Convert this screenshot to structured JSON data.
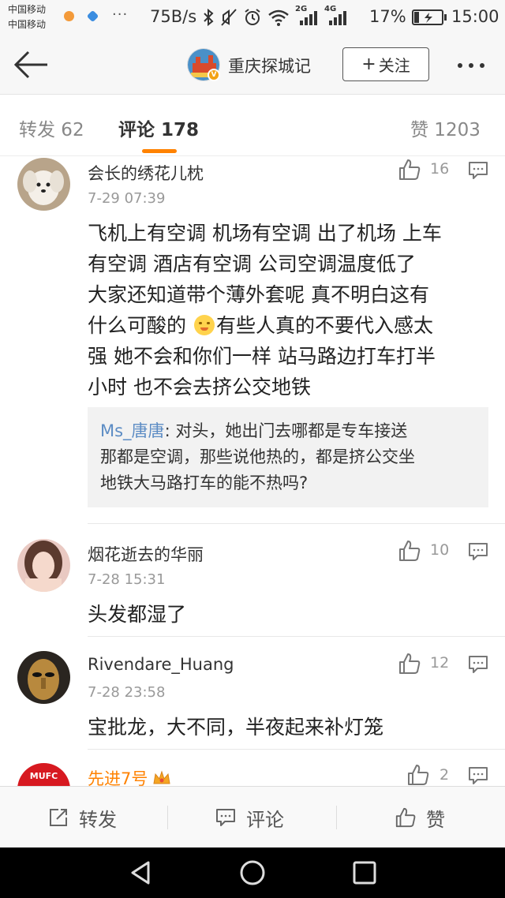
{
  "status_bar": {
    "carrier_1": "中国移动",
    "carrier_2": "中国移动",
    "more": "···",
    "speed": "75B/s",
    "network_2g": "2G",
    "network_4g": "4G",
    "battery": "17%",
    "time": "15:00",
    "icons": [
      "bluetooth-icon",
      "mute-icon",
      "alarm-icon",
      "wifi-icon",
      "signal-icon",
      "signal-icon",
      "battery-charging-icon"
    ]
  },
  "header": {
    "title": "重庆探城记",
    "follow_label": "关注",
    "follow_plus": "+"
  },
  "tabs": {
    "repost": "转发 62",
    "comments": "评论 178",
    "likes": "赞 1203"
  },
  "comments": [
    {
      "name": "会长的绣花儿枕",
      "time": "7-29 07:39",
      "likes": "16",
      "lines": [
        "飞机上有空调 机场有空调 出了机场 上车",
        "有空调  酒店有空调    公司空调温度低了",
        "大家还知道带个薄外套呢  真不明白这有",
        "什么可酸的",
        "有些人真的不要代入感太",
        "强 她不会和你们一样  站马路边打车打半",
        "小时 也不会去挤公交地铁"
      ],
      "reply": {
        "user": "Ms_唐唐",
        "text": ": 对头，她出门去哪都是专车接送",
        "lines": [
          "那都是空调，那些说他热的，都是挤公交坐",
          "地铁大马路打车的能不热吗?"
        ]
      }
    },
    {
      "name": "烟花逝去的华丽",
      "time": "7-28 15:31",
      "likes": "10",
      "text": "头发都湿了"
    },
    {
      "name": "Rivendare_Huang",
      "time": "7-28 23:58",
      "likes": "12",
      "text": "宝批龙，大不同，半夜起来补灯笼"
    },
    {
      "name": "先进7号",
      "likes": "2",
      "avatar_text": "MUFC"
    }
  ],
  "bottom_bar": {
    "repost": "转发",
    "comment": "评论",
    "like": "赞"
  },
  "colors": {
    "accent": "#ff8200",
    "reply_user": "#5c8cc4",
    "background": "#ffffff"
  }
}
